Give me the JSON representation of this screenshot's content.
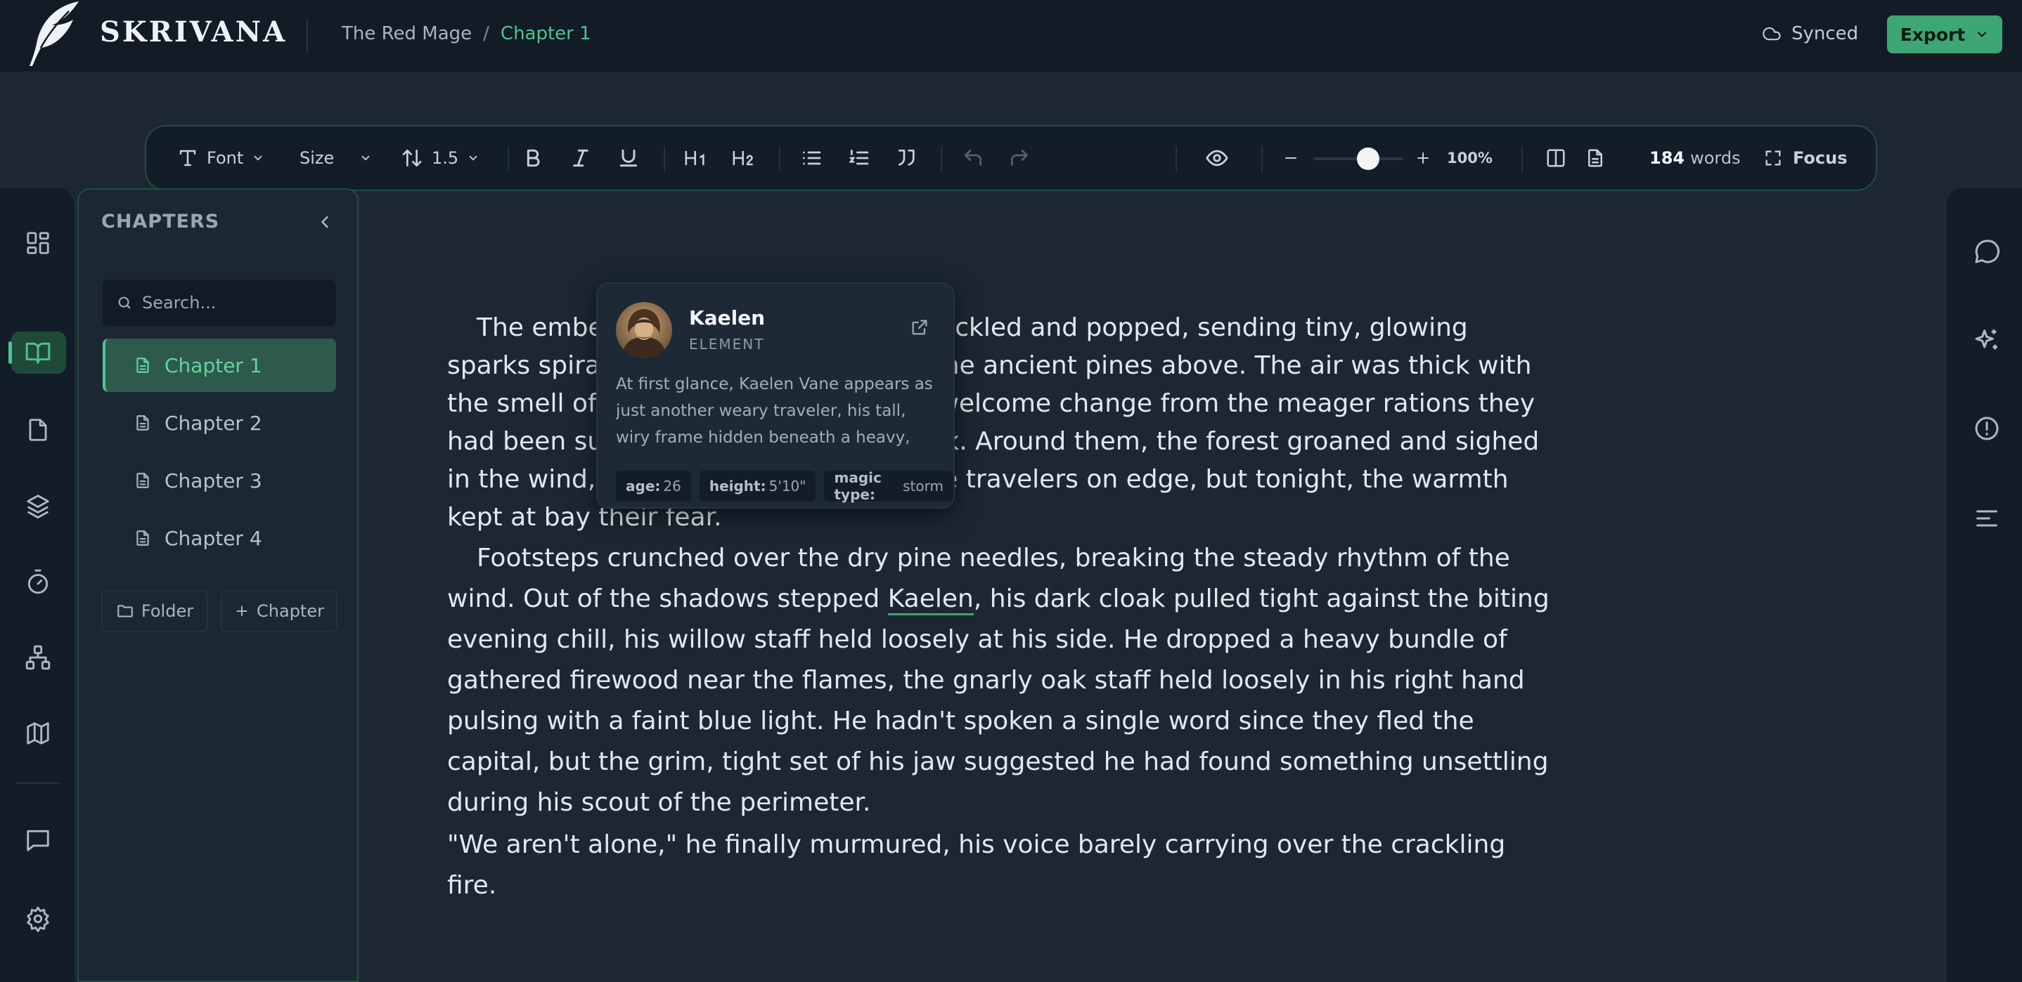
{
  "app": {
    "name": "SKRIVANA"
  },
  "breadcrumb": {
    "project": "The Red Mage",
    "separator": "/",
    "current": "Chapter 1"
  },
  "status": {
    "sync_label": "Synced"
  },
  "export": {
    "label": "Export"
  },
  "toolbar": {
    "font_label": "Font",
    "size_label": "Size",
    "line_height": "1.5",
    "zoom": "100%",
    "word_count": "184",
    "words_label": "words",
    "focus_label": "Focus",
    "slider_value": 0.5
  },
  "chapters_panel": {
    "title": "CHAPTERS",
    "search_placeholder": "Search...",
    "items": [
      {
        "label": "Chapter 1",
        "active": true
      },
      {
        "label": "Chapter 2",
        "active": false
      },
      {
        "label": "Chapter 3",
        "active": false
      },
      {
        "label": "Chapter 4",
        "active": false
      }
    ],
    "add_folder_label": "Folder",
    "add_chapter_label": "Chapter"
  },
  "editor": {
    "p1": "The embers of the dying campfire crackled and popped, sending tiny, glowing sparks spiraling up into the canopy of the ancient pines above. The air was thick with the smell of pine and roasted game, a welcome change from the meager rations they had been surviving on for the past week. Around them, the forest groaned and sighed in the wind, a sound that usually set the travelers on edge, but tonight, the warmth kept at bay their fear.",
    "p2_before": "Footsteps crunched over the dry pine needles, breaking the steady rhythm of the wind. Out of the shadows stepped ",
    "p2_mention": "Kaelen",
    "p2_after": ", his dark cloak pulled tight against the biting evening chill, his willow staff held loosely at his side. He dropped a heavy bundle of gathered firewood near the flames, the gnarly oak staff held loosely in his right hand pulsing with a faint blue light. He hadn't spoken a single word since they fled the capital, but the grim, tight set of his jaw suggested he had found something unsettling during his scout of the perimeter.",
    "p3": "\"We aren't alone,\" he finally murmured, his voice barely carrying over the crackling fire."
  },
  "hovercard": {
    "name": "Kaelen",
    "type": "ELEMENT",
    "description": "At first glance, Kaelen Vane appears as just another weary traveler, his tall, wiry frame hidden beneath a heavy, multi-...",
    "tags": [
      {
        "key": "age:",
        "value": "26"
      },
      {
        "key": "height:",
        "value": "5'10\""
      },
      {
        "key": "magic type:",
        "value": "storm"
      }
    ]
  },
  "colors": {
    "accent": "#4ec58e",
    "export_bg": "#3ea672",
    "background": "#1c2733",
    "panel": "#131d28"
  },
  "icons": {
    "left_rail": [
      "dashboard-icon",
      "book-open-icon",
      "file-icon",
      "layers-icon",
      "timer-icon",
      "hierarchy-icon",
      "map-icon",
      "chat-icon",
      "settings-icon"
    ],
    "right_rail": [
      "comment-icon",
      "sparkles-icon",
      "alert-circle-icon",
      "align-left-icon"
    ]
  }
}
